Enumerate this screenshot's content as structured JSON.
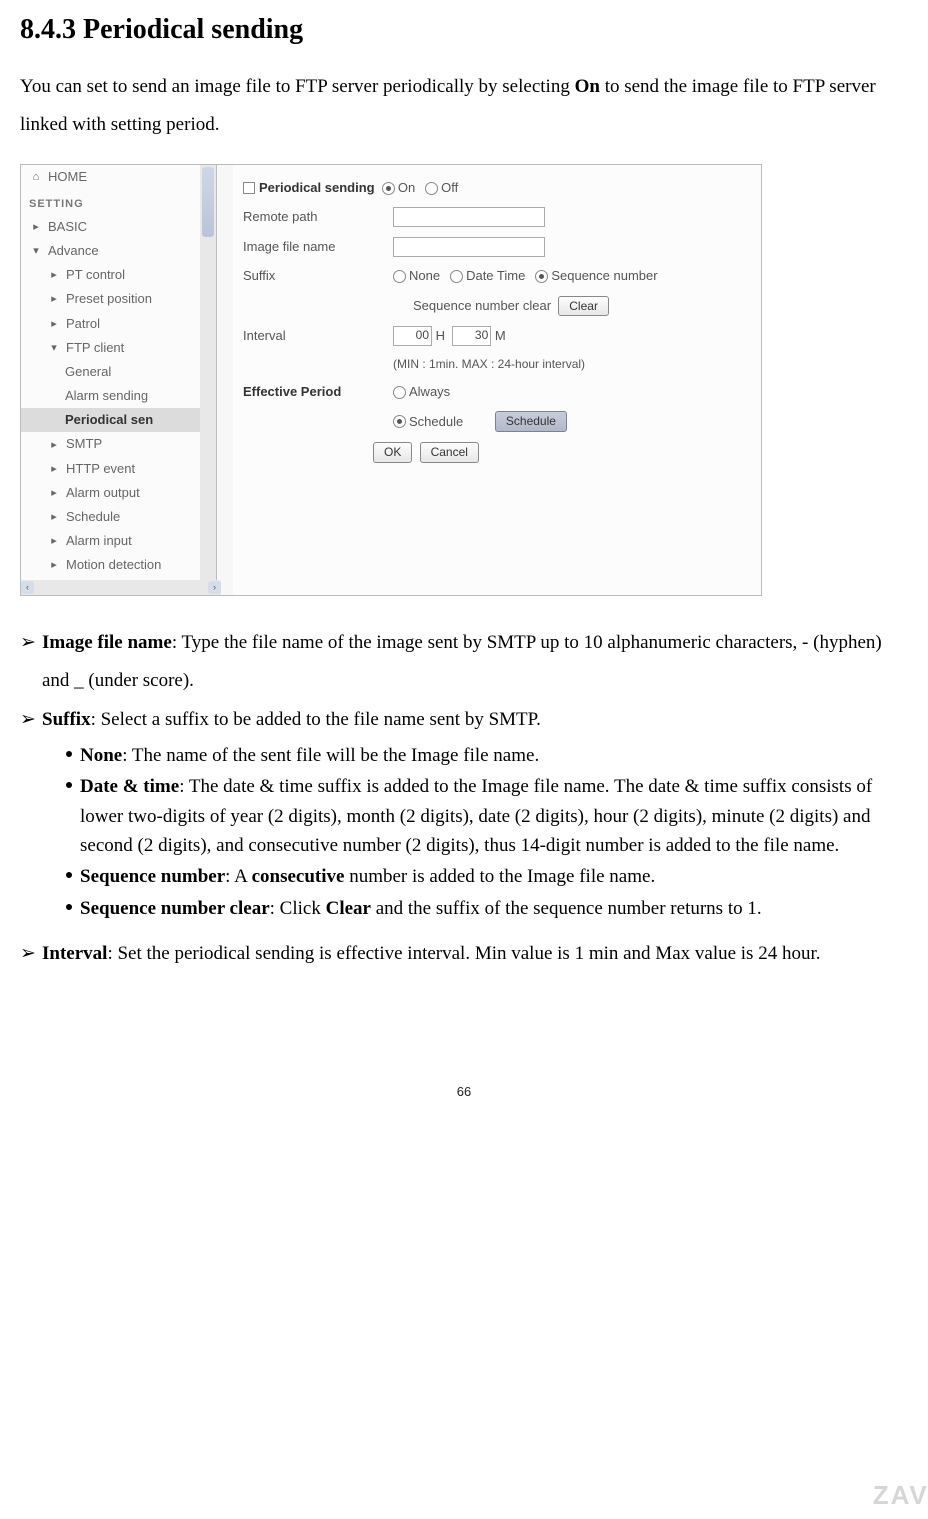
{
  "heading": "8.4.3 Periodical sending",
  "intro_pre": "You can set to send an image file to FTP server periodically by selecting ",
  "intro_bold": "On",
  "intro_post": " to send the image file to FTP server linked with setting period.",
  "sidebar": {
    "home": "HOME",
    "setting": "SETTING",
    "basic": "BASIC",
    "advance": "Advance",
    "items": [
      "PT control",
      "Preset position",
      "Patrol",
      "FTP client",
      "General",
      "Alarm sending",
      "Periodical sen",
      "SMTP",
      "HTTP event",
      "Alarm output",
      "Schedule",
      "Alarm input",
      "Motion detection"
    ]
  },
  "form": {
    "section_label": "Periodical sending",
    "on": "On",
    "off": "Off",
    "remote_path": "Remote path",
    "image_file_name": "Image file name",
    "suffix": "Suffix",
    "none": "None",
    "datetime": "Date Time",
    "seqnum": "Sequence number",
    "seqclear_label": "Sequence number clear",
    "clear_btn": "Clear",
    "interval": "Interval",
    "h_val": "00",
    "h_lbl": "H",
    "m_val": "30",
    "m_lbl": "M",
    "interval_note": "(MIN : 1min. MAX : 24-hour interval)",
    "effective": "Effective Period",
    "always": "Always",
    "schedule": "Schedule",
    "schedule_btn": "Schedule",
    "ok": "OK",
    "cancel": "Cancel"
  },
  "desc": {
    "ifn_lead": "Image file name",
    "ifn_text": ": Type the file name of the image sent by SMTP up to 10 alphanumeric characters, - (hyphen) and _ (under score).",
    "suffix_lead": "Suffix",
    "suffix_text": ": Select a suffix to be added to the file name sent by SMTP.",
    "none_lead": "None",
    "none_text": ": The name of the sent file will be the Image file name.",
    "dt_lead": "Date & time",
    "dt_text": ": The date & time suffix is added to the Image file name. The date & time suffix consists of lower two-digits of year (2 digits), month (2 digits), date (2 digits), hour (2 digits), minute (2 digits) and second (2 digits), and consecutive number (2 digits), thus 14-digit number is added to the file name.",
    "sn_lead": "Sequence number",
    "sn_pre": ": A ",
    "sn_bold": "consecutive",
    "sn_post": " number is added to the Image file name.",
    "snc_lead": "Sequence number clear",
    "snc_pre": ": Click ",
    "snc_bold": "Clear",
    "snc_post": " and the suffix of the sequence number returns to 1.",
    "int_lead": "Interval",
    "int_text": ": Set the periodical sending is effective interval. Min value is 1 min and Max value is 24 hour."
  },
  "page_number": "66",
  "watermark": "ZAVI"
}
